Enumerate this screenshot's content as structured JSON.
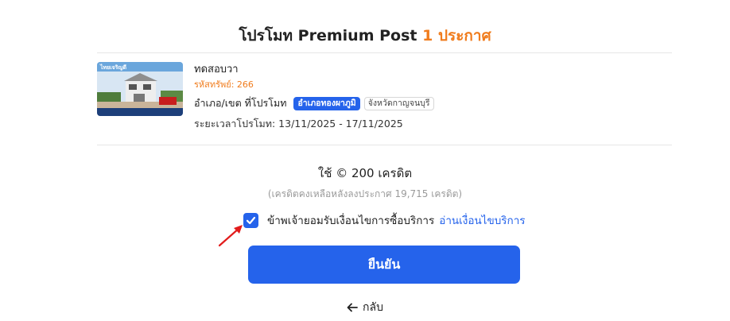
{
  "header": {
    "title": "โปรโมท Premium Post",
    "count_label": "1 ประกาศ"
  },
  "listing": {
    "name": "ทดสอบวา",
    "code": "รหัสทรัพย์: 266",
    "area_label": "อำเภอ/เขต ที่โปรโมท",
    "district_tag": "อำเภอทองผาภูมิ",
    "province_tag": "จังหวัดกาญจนบุรี",
    "period": "ระยะเวลาโปรโมท: 13/11/2025 - 17/11/2025",
    "thumbnail_overlay_text": "ไทยเจริญดี"
  },
  "cost": {
    "text": "ใช้ © 200 เครดิต",
    "remaining": "(เครดิตคงเหลือหลังลงประกาศ 19,715 เครดิต)"
  },
  "agreement": {
    "checked": true,
    "text": "ข้าพเจ้ายอมรับเงื่อนไขการซื้อบริการ",
    "link": "อ่านเงื่อนไขบริการ"
  },
  "actions": {
    "confirm_label": "ยืนยัน",
    "back_label": "กลับ"
  },
  "colors": {
    "accent_orange": "#f07c1d",
    "primary_blue": "#2563eb",
    "annotation_red": "#e21c1c"
  }
}
